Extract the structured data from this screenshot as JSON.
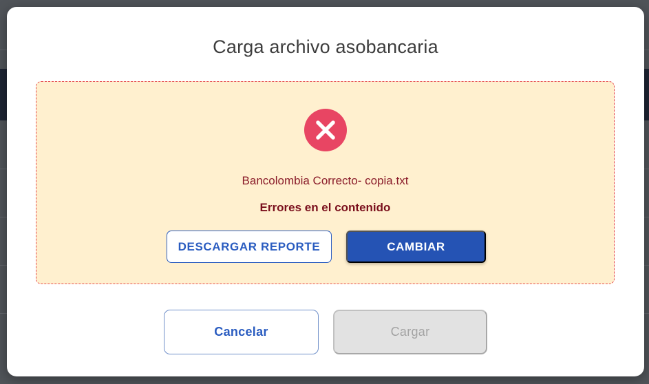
{
  "dialog": {
    "title": "Carga archivo asobancaria"
  },
  "upload_status": {
    "icon": "error-x-circle-icon",
    "icon_color": "#e84563",
    "panel_color": "#fff0cf",
    "file_name": "Bancolombia Correcto- copia.txt",
    "error_message": "Errores en el contenido"
  },
  "panel_actions": {
    "download_report_label": "DESCARGAR REPORTE",
    "change_label": "CAMBIAR"
  },
  "footer": {
    "cancel_label": "Cancelar",
    "load_label": "Cargar",
    "load_enabled": false
  },
  "colors": {
    "primary": "#2553b4",
    "error_text": "#7a0f1c",
    "disabled_bg": "#e2e2e2"
  }
}
